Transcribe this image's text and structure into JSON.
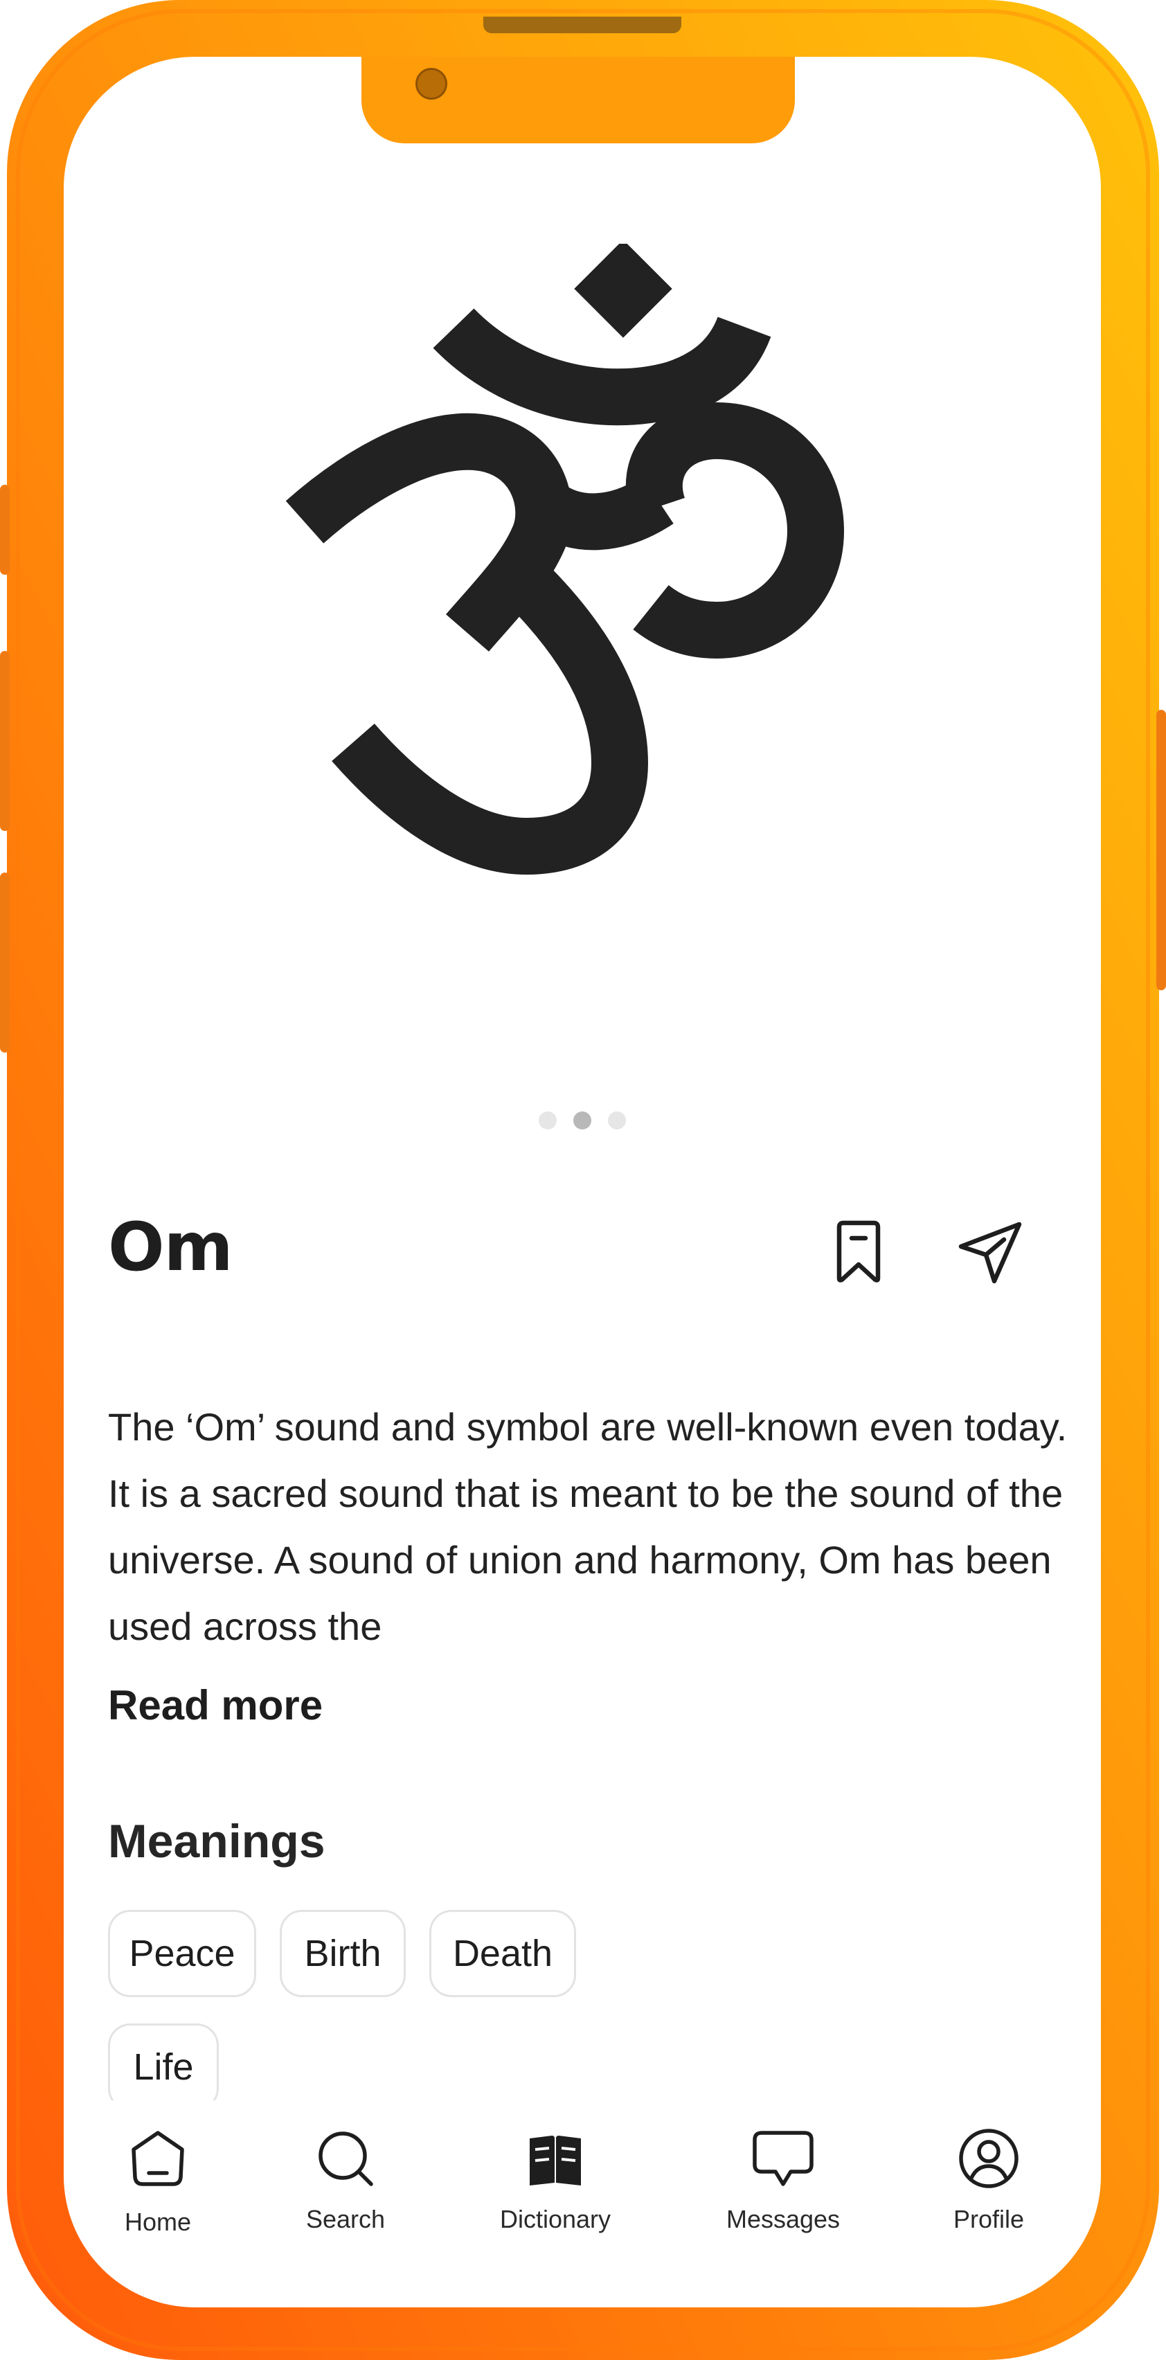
{
  "symbol": {
    "name": "Om",
    "description": "The ‘Om’ sound and symbol are well-known even today. It is a sacred sound that is meant to be the sound of the universe. A sound of union and harmony, Om has been used across the",
    "read_more": "Read more",
    "carousel": {
      "count": 3,
      "active_index": 1
    }
  },
  "actions": {
    "bookmark_icon": "bookmark-icon",
    "share_icon": "send-icon"
  },
  "meanings": {
    "title": "Meanings",
    "chips": [
      "Peace",
      "Birth",
      "Death",
      "Life"
    ]
  },
  "tabbar": {
    "items": [
      {
        "label": "Home",
        "icon": "home-icon"
      },
      {
        "label": "Search",
        "icon": "search-icon"
      },
      {
        "label": "Dictionary",
        "icon": "book-icon"
      },
      {
        "label": "Messages",
        "icon": "message-icon"
      },
      {
        "label": "Profile",
        "icon": "profile-icon"
      }
    ]
  },
  "colors": {
    "frame_light": "#ffc107",
    "frame_mid": "#ff9f0a",
    "frame_dark": "#ff5a0a",
    "ink": "#222222"
  }
}
